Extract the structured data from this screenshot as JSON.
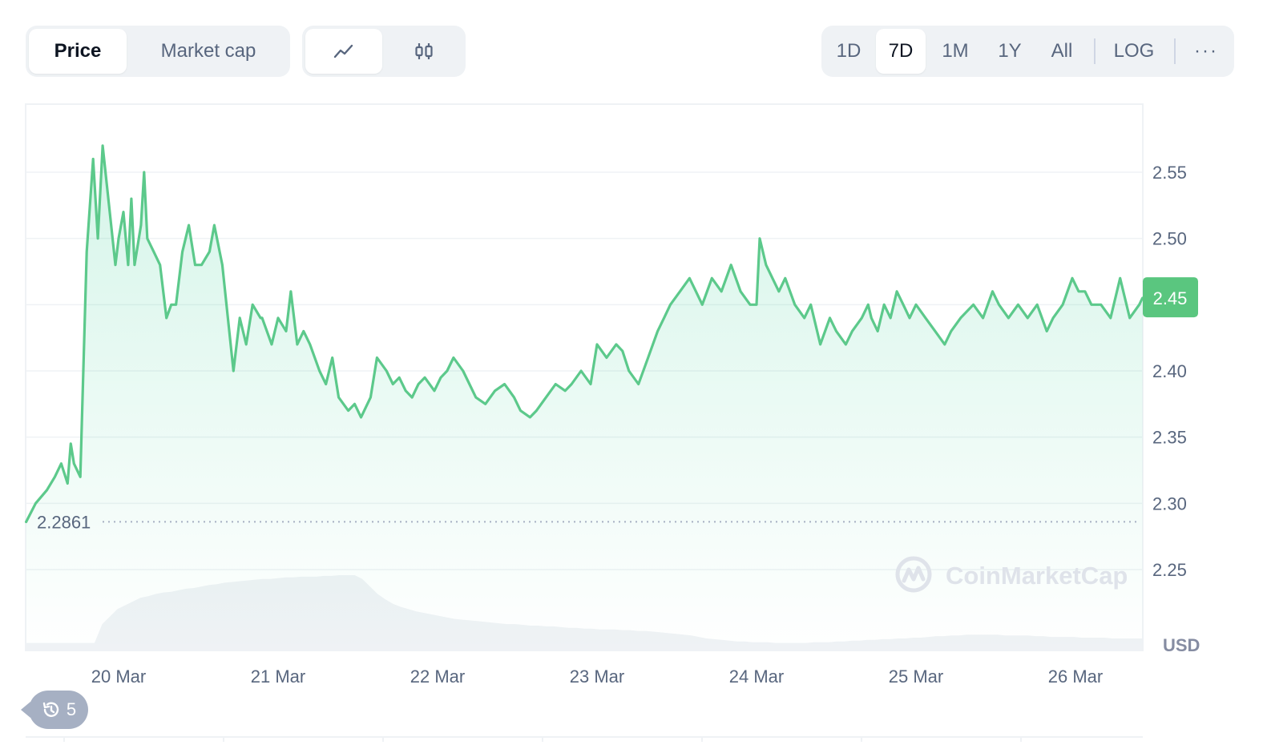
{
  "toolbar": {
    "metric_tabs": [
      "Price",
      "Market cap"
    ],
    "active_metric": "Price",
    "chart_style_buttons": [
      "line-chart-icon",
      "candlestick-icon"
    ],
    "active_style": "line-chart-icon",
    "range_tabs": [
      "1D",
      "7D",
      "1M",
      "1Y",
      "All"
    ],
    "active_range": "7D",
    "scale_button": "LOG",
    "more_button": "···"
  },
  "colors": {
    "line": "#16c784",
    "line_stroke": "#5cc98b",
    "current_price_bg": "#5ac67f",
    "volume": "#eff2f5",
    "grid": "#eff2f5",
    "axis_text": "#58667e"
  },
  "history_badge": {
    "icon": "history-icon",
    "count": "5"
  },
  "watermark": "CoinMarketCap",
  "chart_data": {
    "type": "area",
    "title": "",
    "xlabel": "",
    "ylabel": "",
    "currency_label": "USD",
    "x_tick_labels": [
      "20 Mar",
      "21 Mar",
      "22 Mar",
      "23 Mar",
      "24 Mar",
      "25 Mar",
      "26 Mar"
    ],
    "y_tick_labels": [
      "2.55",
      "2.50",
      "2.40",
      "2.35",
      "2.30",
      "2.25"
    ],
    "ylim": [
      2.2,
      2.6
    ],
    "grid": true,
    "open_price_label": "2.2861",
    "open_price": 2.2861,
    "current_price_label": "2.45",
    "current_price": 2.455,
    "series": [
      {
        "x_days_from_20_Mar": [
          -0.58,
          -0.52,
          -0.45,
          -0.4,
          -0.36,
          -0.32,
          -0.3,
          -0.28,
          -0.24,
          -0.2,
          -0.16,
          -0.13,
          -0.1,
          -0.02,
          0.0,
          0.03,
          0.06,
          0.08,
          0.1,
          0.14,
          0.16,
          0.18,
          0.22,
          0.26,
          0.3,
          0.33,
          0.36,
          0.4,
          0.44,
          0.48,
          0.52,
          0.57,
          0.6,
          0.65,
          0.72,
          0.76,
          0.8,
          0.84,
          0.89,
          0.9,
          0.96,
          1.0,
          1.05,
          1.08,
          1.12,
          1.16,
          1.2,
          1.26,
          1.3,
          1.34,
          1.38,
          1.44,
          1.48,
          1.52,
          1.58,
          1.62,
          1.68,
          1.72,
          1.76,
          1.8,
          1.84,
          1.88,
          1.92,
          1.98,
          2.02,
          2.06,
          2.1,
          2.16,
          2.2,
          2.24,
          2.3,
          2.36,
          2.42,
          2.48,
          2.52,
          2.58,
          2.62,
          2.68,
          2.74,
          2.8,
          2.84,
          2.9,
          2.96,
          3.0,
          3.06,
          3.12,
          3.16,
          3.2,
          3.26,
          3.32,
          3.38,
          3.42,
          3.46,
          3.52,
          3.58,
          3.62,
          3.66,
          3.72,
          3.78,
          3.84,
          3.9,
          3.96,
          4.0,
          4.02,
          4.06,
          4.1,
          4.14,
          4.18,
          4.24,
          4.3,
          4.34,
          4.4,
          4.46,
          4.5,
          4.56,
          4.6,
          4.66,
          4.7,
          4.72,
          4.76,
          4.8,
          4.84,
          4.88,
          4.92,
          4.96,
          5.0,
          5.06,
          5.12,
          5.18,
          5.22,
          5.28,
          5.36,
          5.42,
          5.48,
          5.52,
          5.58,
          5.64,
          5.7,
          5.76,
          5.82,
          5.86,
          5.92,
          5.98,
          6.02,
          6.06,
          6.1,
          6.16,
          6.22,
          6.28,
          6.34,
          6.4,
          6.42
        ],
        "y": [
          2.286,
          2.3,
          2.31,
          2.32,
          2.33,
          2.315,
          2.345,
          2.33,
          2.32,
          2.49,
          2.56,
          2.5,
          2.57,
          2.48,
          2.5,
          2.52,
          2.48,
          2.53,
          2.48,
          2.51,
          2.55,
          2.5,
          2.49,
          2.48,
          2.44,
          2.45,
          2.45,
          2.49,
          2.51,
          2.48,
          2.48,
          2.49,
          2.51,
          2.48,
          2.4,
          2.44,
          2.42,
          2.45,
          2.44,
          2.44,
          2.42,
          2.44,
          2.43,
          2.46,
          2.42,
          2.43,
          2.42,
          2.4,
          2.39,
          2.41,
          2.38,
          2.37,
          2.375,
          2.365,
          2.38,
          2.41,
          2.4,
          2.39,
          2.395,
          2.385,
          2.38,
          2.39,
          2.395,
          2.385,
          2.395,
          2.4,
          2.41,
          2.4,
          2.39,
          2.38,
          2.375,
          2.385,
          2.39,
          2.38,
          2.37,
          2.365,
          2.37,
          2.38,
          2.39,
          2.385,
          2.39,
          2.4,
          2.39,
          2.42,
          2.41,
          2.42,
          2.415,
          2.4,
          2.39,
          2.41,
          2.43,
          2.44,
          2.45,
          2.46,
          2.47,
          2.46,
          2.45,
          2.47,
          2.46,
          2.48,
          2.46,
          2.45,
          2.45,
          2.5,
          2.48,
          2.47,
          2.46,
          2.47,
          2.45,
          2.44,
          2.45,
          2.42,
          2.44,
          2.43,
          2.42,
          2.43,
          2.44,
          2.45,
          2.44,
          2.43,
          2.45,
          2.44,
          2.46,
          2.45,
          2.44,
          2.45,
          2.44,
          2.43,
          2.42,
          2.43,
          2.44,
          2.45,
          2.44,
          2.46,
          2.45,
          2.44,
          2.45,
          2.44,
          2.45,
          2.43,
          2.44,
          2.45,
          2.47,
          2.46,
          2.46,
          2.45,
          2.45,
          2.44,
          2.47,
          2.44,
          2.45,
          2.455
        ]
      }
    ],
    "volume_relative": [
      0.1,
      0.1,
      0.1,
      0.1,
      0.1,
      0.1,
      0.1,
      0.1,
      0.1,
      0.1,
      0.35,
      0.45,
      0.55,
      0.6,
      0.65,
      0.7,
      0.72,
      0.75,
      0.77,
      0.78,
      0.8,
      0.82,
      0.83,
      0.85,
      0.87,
      0.88,
      0.9,
      0.91,
      0.92,
      0.93,
      0.94,
      0.95,
      0.95,
      0.96,
      0.97,
      0.97,
      0.98,
      0.98,
      0.98,
      0.99,
      0.99,
      1.0,
      1.0,
      1.0,
      0.95,
      0.85,
      0.75,
      0.68,
      0.62,
      0.58,
      0.55,
      0.52,
      0.5,
      0.48,
      0.46,
      0.44,
      0.42,
      0.41,
      0.4,
      0.39,
      0.38,
      0.37,
      0.36,
      0.35,
      0.35,
      0.34,
      0.33,
      0.33,
      0.32,
      0.32,
      0.31,
      0.3,
      0.3,
      0.29,
      0.29,
      0.28,
      0.28,
      0.28,
      0.27,
      0.27,
      0.26,
      0.26,
      0.25,
      0.24,
      0.23,
      0.22,
      0.21,
      0.2,
      0.18,
      0.16,
      0.15,
      0.14,
      0.13,
      0.12,
      0.12,
      0.11,
      0.11,
      0.11,
      0.1,
      0.1,
      0.1,
      0.1,
      0.1,
      0.11,
      0.11,
      0.11,
      0.12,
      0.12,
      0.13,
      0.13,
      0.14,
      0.14,
      0.15,
      0.15,
      0.16,
      0.16,
      0.17,
      0.17,
      0.18,
      0.19,
      0.19,
      0.2,
      0.2,
      0.21,
      0.21,
      0.21,
      0.21,
      0.21,
      0.2,
      0.2,
      0.2,
      0.2,
      0.19,
      0.19,
      0.18,
      0.18,
      0.18,
      0.18,
      0.17,
      0.17,
      0.17,
      0.17,
      0.16,
      0.16,
      0.16,
      0.16,
      0.16
    ]
  }
}
